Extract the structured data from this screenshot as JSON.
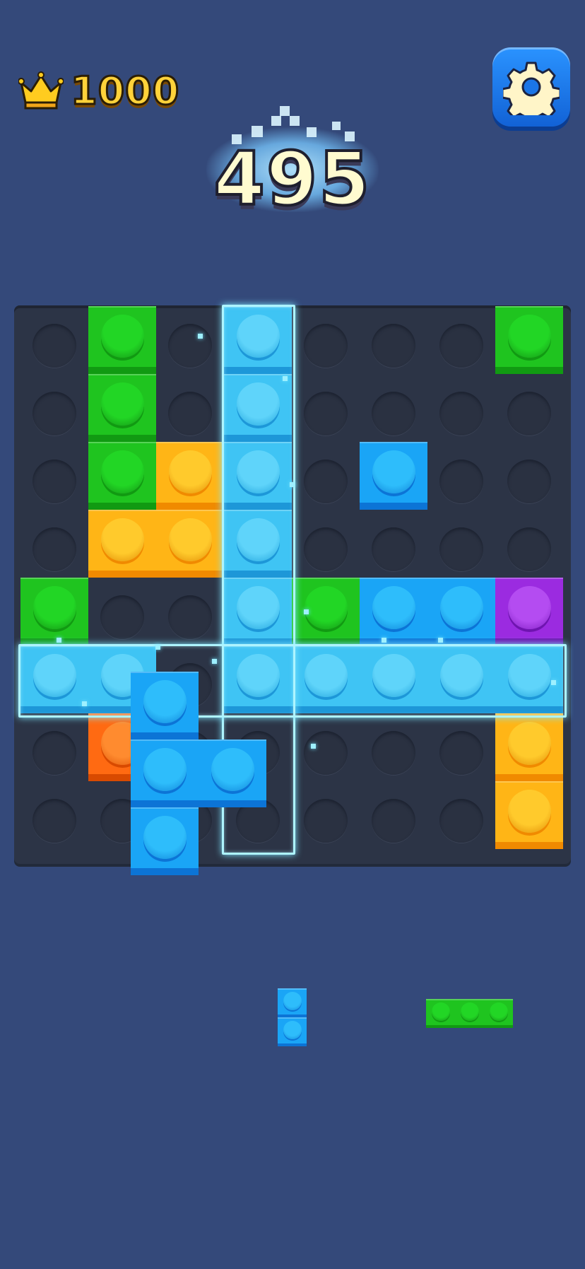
{
  "hud": {
    "best_score": "1000",
    "current_score": "495",
    "best_icon": "crown-icon",
    "settings_icon": "gear-icon"
  },
  "colors": {
    "background": "#34497a",
    "board": "#2c3446",
    "green": "#19c01d",
    "yellow": "#ffb516",
    "blue": "#1aa5f6",
    "light_blue": "#3fc4f4",
    "purple": "#9b2be0",
    "orange": "#ff6a12",
    "highlight": "#aef4ff"
  },
  "board": {
    "columns": 8,
    "rows": 8,
    "placed_blocks": [
      {
        "row": 0,
        "col": 1,
        "color": "green"
      },
      {
        "row": 1,
        "col": 1,
        "color": "green"
      },
      {
        "row": 2,
        "col": 1,
        "color": "green"
      },
      {
        "row": 0,
        "col": 3,
        "color": "light_blue"
      },
      {
        "row": 1,
        "col": 3,
        "color": "light_blue"
      },
      {
        "row": 2,
        "col": 3,
        "color": "light_blue"
      },
      {
        "row": 3,
        "col": 3,
        "color": "light_blue"
      },
      {
        "row": 4,
        "col": 3,
        "color": "light_blue"
      },
      {
        "row": 0,
        "col": 7,
        "color": "green"
      },
      {
        "row": 2,
        "col": 2,
        "color": "yellow"
      },
      {
        "row": 3,
        "col": 1,
        "color": "yellow"
      },
      {
        "row": 3,
        "col": 2,
        "color": "yellow"
      },
      {
        "row": 2,
        "col": 5,
        "color": "blue"
      },
      {
        "row": 4,
        "col": 0,
        "color": "green"
      },
      {
        "row": 4,
        "col": 4,
        "color": "green"
      },
      {
        "row": 4,
        "col": 5,
        "color": "blue"
      },
      {
        "row": 4,
        "col": 6,
        "color": "blue"
      },
      {
        "row": 4,
        "col": 7,
        "color": "purple"
      },
      {
        "row": 5,
        "col": 0,
        "color": "light_blue"
      },
      {
        "row": 5,
        "col": 1,
        "color": "light_blue"
      },
      {
        "row": 5,
        "col": 3,
        "color": "light_blue"
      },
      {
        "row": 5,
        "col": 4,
        "color": "light_blue"
      },
      {
        "row": 5,
        "col": 5,
        "color": "light_blue"
      },
      {
        "row": 5,
        "col": 6,
        "color": "light_blue"
      },
      {
        "row": 5,
        "col": 7,
        "color": "light_blue"
      },
      {
        "row": 6,
        "col": 1,
        "color": "orange"
      },
      {
        "row": 6,
        "col": 7,
        "color": "yellow"
      },
      {
        "row": 7,
        "col": 7,
        "color": "yellow"
      }
    ],
    "dragged_piece": {
      "color": "blue",
      "cells": [
        [
          0,
          0
        ],
        [
          1,
          0
        ],
        [
          1,
          1
        ],
        [
          2,
          0
        ]
      ]
    }
  },
  "tray": [
    {
      "color": "blue",
      "cells": [
        [
          0,
          0
        ],
        [
          1,
          0
        ]
      ]
    },
    {
      "color": "green",
      "cells": [
        [
          0,
          0
        ],
        [
          0,
          1
        ],
        [
          0,
          2
        ]
      ]
    }
  ]
}
